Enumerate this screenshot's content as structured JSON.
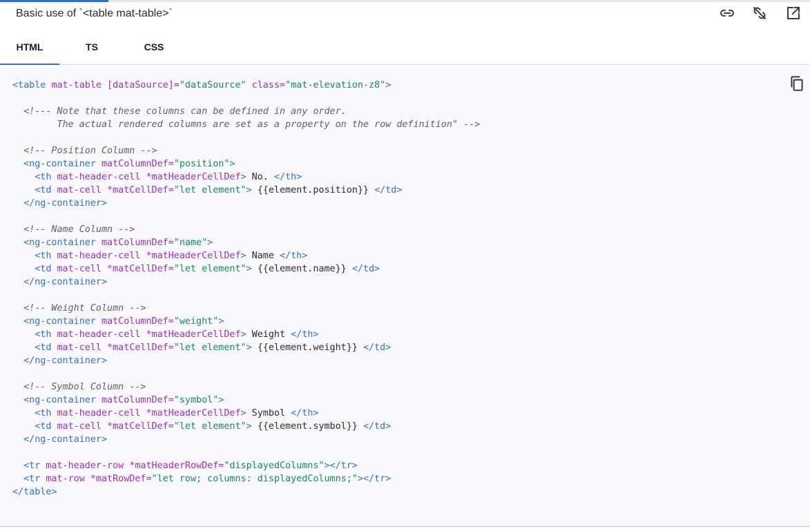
{
  "header": {
    "title": "Basic use of `<table mat-table>`",
    "icons": {
      "link": "link-icon",
      "unlink": "link-off-icon",
      "open": "open-in-new-icon"
    }
  },
  "progress": {
    "fraction": 0.134
  },
  "tabs": [
    {
      "label": "HTML",
      "active": true
    },
    {
      "label": "TS",
      "active": false
    },
    {
      "label": "CSS",
      "active": false
    }
  ],
  "code": {
    "copy_icon": "copy-icon",
    "lines": [
      [
        [
          "t",
          "<table "
        ],
        [
          "a",
          "mat-table [dataSource]="
        ],
        [
          "s",
          "\"dataSource\""
        ],
        [
          "a",
          " class="
        ],
        [
          "s",
          "\"mat-elevation-z8\""
        ],
        [
          "t",
          ">"
        ]
      ],
      [],
      [
        [
          "c",
          "  <!--- Note that these columns can be defined in any order."
        ]
      ],
      [
        [
          "c",
          "        The actual rendered columns are set as a property on the row definition\" -->"
        ]
      ],
      [],
      [
        [
          "c",
          "  <!-- Position Column -->"
        ]
      ],
      [
        [
          "t",
          "  <ng-container "
        ],
        [
          "a",
          "matColumnDef="
        ],
        [
          "s",
          "\"position\""
        ],
        [
          "t",
          ">"
        ]
      ],
      [
        [
          "t",
          "    <th "
        ],
        [
          "a",
          "mat-header-cell *matHeaderCellDef"
        ],
        [
          "t",
          ">"
        ],
        [
          "x",
          " No. "
        ],
        [
          "t",
          "</th>"
        ]
      ],
      [
        [
          "t",
          "    <td "
        ],
        [
          "a",
          "mat-cell *matCellDef="
        ],
        [
          "s",
          "\"let element\""
        ],
        [
          "t",
          ">"
        ],
        [
          "x",
          " {{element.position}} "
        ],
        [
          "t",
          "</td>"
        ]
      ],
      [
        [
          "t",
          "  </ng-container>"
        ]
      ],
      [],
      [
        [
          "c",
          "  <!-- Name Column -->"
        ]
      ],
      [
        [
          "t",
          "  <ng-container "
        ],
        [
          "a",
          "matColumnDef="
        ],
        [
          "s",
          "\"name\""
        ],
        [
          "t",
          ">"
        ]
      ],
      [
        [
          "t",
          "    <th "
        ],
        [
          "a",
          "mat-header-cell *matHeaderCellDef"
        ],
        [
          "t",
          ">"
        ],
        [
          "x",
          " Name "
        ],
        [
          "t",
          "</th>"
        ]
      ],
      [
        [
          "t",
          "    <td "
        ],
        [
          "a",
          "mat-cell *matCellDef="
        ],
        [
          "s",
          "\"let element\""
        ],
        [
          "t",
          ">"
        ],
        [
          "x",
          " {{element.name}} "
        ],
        [
          "t",
          "</td>"
        ]
      ],
      [
        [
          "t",
          "  </ng-container>"
        ]
      ],
      [],
      [
        [
          "c",
          "  <!-- Weight Column -->"
        ]
      ],
      [
        [
          "t",
          "  <ng-container "
        ],
        [
          "a",
          "matColumnDef="
        ],
        [
          "s",
          "\"weight\""
        ],
        [
          "t",
          ">"
        ]
      ],
      [
        [
          "t",
          "    <th "
        ],
        [
          "a",
          "mat-header-cell *matHeaderCellDef"
        ],
        [
          "t",
          ">"
        ],
        [
          "x",
          " Weight "
        ],
        [
          "t",
          "</th>"
        ]
      ],
      [
        [
          "t",
          "    <td "
        ],
        [
          "a",
          "mat-cell *matCellDef="
        ],
        [
          "s",
          "\"let element\""
        ],
        [
          "t",
          ">"
        ],
        [
          "x",
          " {{element.weight}} "
        ],
        [
          "t",
          "</td>"
        ]
      ],
      [
        [
          "t",
          "  </ng-container>"
        ]
      ],
      [],
      [
        [
          "c",
          "  <!-- Symbol Column -->"
        ]
      ],
      [
        [
          "t",
          "  <ng-container "
        ],
        [
          "a",
          "matColumnDef="
        ],
        [
          "s",
          "\"symbol\""
        ],
        [
          "t",
          ">"
        ]
      ],
      [
        [
          "t",
          "    <th "
        ],
        [
          "a",
          "mat-header-cell *matHeaderCellDef"
        ],
        [
          "t",
          ">"
        ],
        [
          "x",
          " Symbol "
        ],
        [
          "t",
          "</th>"
        ]
      ],
      [
        [
          "t",
          "    <td "
        ],
        [
          "a",
          "mat-cell *matCellDef="
        ],
        [
          "s",
          "\"let element\""
        ],
        [
          "t",
          ">"
        ],
        [
          "x",
          " {{element.symbol}} "
        ],
        [
          "t",
          "</td>"
        ]
      ],
      [
        [
          "t",
          "  </ng-container>"
        ]
      ],
      [],
      [
        [
          "t",
          "  <tr "
        ],
        [
          "a",
          "mat-header-row *matHeaderRowDef="
        ],
        [
          "s",
          "\"displayedColumns\""
        ],
        [
          "t",
          "></tr>"
        ]
      ],
      [
        [
          "t",
          "  <tr "
        ],
        [
          "a",
          "mat-row *matRowDef="
        ],
        [
          "s",
          "\"let row; columns: displayedColumns;\""
        ],
        [
          "t",
          "></tr>"
        ]
      ],
      [
        [
          "t",
          "</table>"
        ]
      ]
    ]
  }
}
